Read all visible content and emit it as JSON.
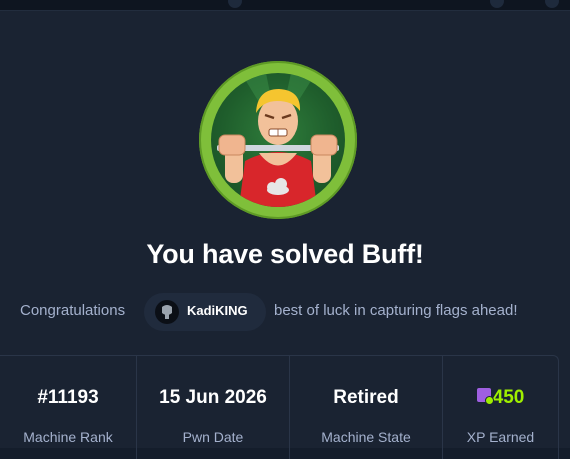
{
  "headline": "You have solved Buff!",
  "congrats": {
    "prefix": "Congratulations",
    "username": "KadiKING",
    "suffix": "best of luck in capturing flags ahead!"
  },
  "machine": {
    "name": "Buff",
    "avatar_icon": "weightlifter-avatar",
    "ring_color": "#7fbf3a"
  },
  "stats": [
    {
      "value": "#11193",
      "label": "Machine Rank"
    },
    {
      "value": "15 Jun 2026",
      "label": "Pwn Date"
    },
    {
      "value": "Retired",
      "label": "Machine State"
    },
    {
      "value": "450",
      "label": "XP Earned",
      "icon": "xp-icon"
    }
  ],
  "colors": {
    "accent": "#9fef00",
    "background": "#1a2332",
    "muted_text": "#a4b1cd",
    "xp_badge": "#9f5fe0"
  }
}
